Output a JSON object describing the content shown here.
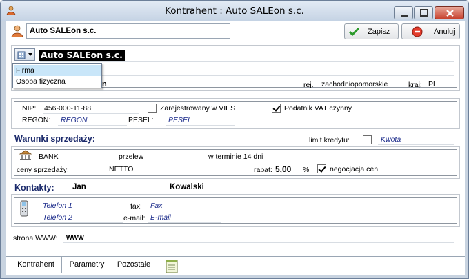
{
  "window": {
    "title": "Kontrahent : Auto SALEon s.c."
  },
  "header": {
    "name": "Auto SALEon s.c.",
    "save_label": "Zapisz",
    "cancel_label": "Anuluj"
  },
  "identity": {
    "selected_name": "Auto SALEon s.c.",
    "type_menu": [
      "Firma",
      "Osoba fizyczna"
    ],
    "partial_text": "n",
    "region_label": "rej.",
    "region_value": "zachodniopomorskie",
    "country_label": "kraj:",
    "country_value": "PL"
  },
  "tax": {
    "nip_label": "NIP:",
    "nip_value": "456-000-11-88",
    "vies_label": "Zarejestrowany w VIES",
    "vies_checked": false,
    "vat_label": "Podatnik VAT czynny",
    "vat_checked": true,
    "regon_label": "REGON:",
    "regon_value": "REGON",
    "pesel_label": "PESEL:",
    "pesel_value": "PESEL"
  },
  "sales": {
    "section_title": "Warunki sprzedaży:",
    "credit_label": "limit kredytu:",
    "credit_checked": false,
    "credit_value": "Kwota",
    "payment_method": "BANK",
    "payment_type": "przelew",
    "payment_term": "w terminie 14 dni",
    "prices_label": "ceny sprzedaży:",
    "prices_value": "NETTO",
    "discount_label": "rabat:",
    "discount_value": "5,00",
    "discount_unit": "%",
    "negotiation_label": "negocjacja cen",
    "negotiation_checked": true
  },
  "contacts": {
    "section_title": "Kontakty:",
    "first_name": "Jan",
    "last_name": "Kowalski",
    "phone1": "Telefon 1",
    "phone2": "Telefon 2",
    "fax_label": "fax:",
    "fax_value": "Fax",
    "email_label": "e-mail:",
    "email_value": "E-mail"
  },
  "www": {
    "label": "strona WWW:",
    "value": "www"
  },
  "tabs": [
    "Kontrahent",
    "Parametry",
    "Pozostałe"
  ]
}
